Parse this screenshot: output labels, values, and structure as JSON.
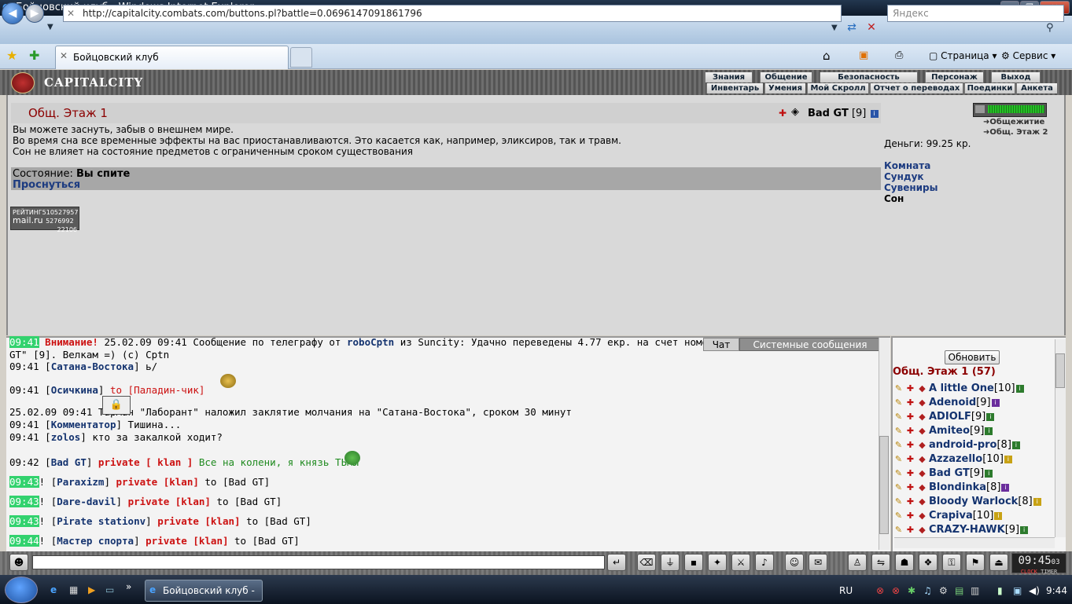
{
  "window": {
    "title": "Бойцовский клуб - Windows Internet Explorer"
  },
  "browser": {
    "url": "http://capitalcity.combats.com/buttons.pl?battle=0.0696147091861796",
    "search_placeholder": "Яндекс",
    "tab_title": "Бойцовский клуб",
    "cmd_page": "Страница",
    "cmd_tools": "Сервис"
  },
  "game": {
    "logo": "CAPITALCITY",
    "menu_top": [
      "Знания",
      "Общение",
      "Безопасность",
      "Персонаж",
      "Выход"
    ],
    "menu_bottom": [
      "Инвентарь",
      "Умения",
      "Мой Скролл",
      "Отчет о переводах",
      "Поединки",
      "Анкета"
    ]
  },
  "room": {
    "title": "Общ. Этаж 1",
    "player": "Bad GT",
    "player_level": "[9]",
    "messages": [
      "Вы можете заснуть, забыв о внешнем мире.",
      "Во время сна все временные эффекты на вас приостанавливаются. Это касается как, например, эликсиров, так и травм.",
      "Сон не влияет на состояние предметов с ограниченным сроком существования"
    ],
    "state_label": "Состояние:",
    "state_value": "Вы спите",
    "wake_link": "Проснуться",
    "rating": {
      "label": "РЕЙТИНГ",
      "mail": "mail.ru",
      "n1": "510527957",
      "n2": "5276992",
      "n3": "22106"
    }
  },
  "sidebar": {
    "money": "Деньги: 99.25 кр.",
    "nav": [
      "Общежитие",
      "Общ. Этаж 2"
    ],
    "links": [
      "Комната",
      "Сундук",
      "Сувениры"
    ],
    "current": "Сон"
  },
  "chat": {
    "tabs": [
      "Чат",
      "Системные сообщения"
    ],
    "lines": [
      {
        "time": "09:41",
        "hl": true,
        "pre": "",
        "parts": [
          {
            "t": "Внимание! ",
            "c": "pv"
          },
          {
            "t": "25.02.09 09:41 Сообщение по телеграфу от ",
            "c": ""
          },
          {
            "t": "roboCptn",
            "c": "nm"
          },
          {
            "t": " из Suncity: Удачно переведены 4.77 екр. на счет номер",
            "c": ""
          }
        ]
      },
      {
        "time": "",
        "hl": false,
        "pre": "",
        "parts": [
          {
            "t": "GT\" [9]. Велкам =) (с) Cptn",
            "c": ""
          }
        ]
      },
      {
        "time": "09:41",
        "hl": false,
        "pre": "",
        "parts": [
          {
            "t": "[",
            "c": ""
          },
          {
            "t": "Сатана-Востока",
            "c": "nm"
          },
          {
            "t": "] ь/",
            "c": ""
          }
        ]
      },
      {
        "time": "09:41",
        "hl": false,
        "pre": "",
        "parts": [
          {
            "t": "[",
            "c": ""
          },
          {
            "t": "Осичкина",
            "c": "nm"
          },
          {
            "t": "] ",
            "c": ""
          },
          {
            "t": "to [Паладин-чик]",
            "c": "pvn"
          }
        ]
      },
      {
        "time": "25.02.09 09:41",
        "hl": false,
        "pre": "",
        "parts": [
          {
            "t": "  Тарман \"Лаборант\" наложил заклятие молчания на \"Сатана-Востока\", сроком 30 минут",
            "c": ""
          }
        ]
      },
      {
        "time": "09:41",
        "hl": false,
        "pre": "",
        "parts": [
          {
            "t": "[",
            "c": ""
          },
          {
            "t": "Комментатор",
            "c": "nm"
          },
          {
            "t": "] Тишина...",
            "c": ""
          }
        ]
      },
      {
        "time": "09:41",
        "hl": false,
        "pre": "",
        "parts": [
          {
            "t": "[",
            "c": ""
          },
          {
            "t": "zolos",
            "c": "nm"
          },
          {
            "t": "] кто за закалкой ходит?",
            "c": ""
          }
        ]
      },
      {
        "time": "09:42",
        "hl": false,
        "pre": "",
        "parts": [
          {
            "t": "[",
            "c": ""
          },
          {
            "t": "Bad GT",
            "c": "nm"
          },
          {
            "t": "] ",
            "c": ""
          },
          {
            "t": "private [ klan ]",
            "c": "pv"
          },
          {
            "t": " Все на колени, я князь ТЬМЫ",
            "c": "gr"
          }
        ]
      },
      {
        "time": "09:43",
        "hl": true,
        "pre": "! ",
        "parts": [
          {
            "t": "[",
            "c": ""
          },
          {
            "t": "Paraxizm",
            "c": "nm"
          },
          {
            "t": "] ",
            "c": ""
          },
          {
            "t": "private [klan]",
            "c": "pv"
          },
          {
            "t": " to [Bad GT]",
            "c": ""
          }
        ]
      },
      {
        "time": "09:43",
        "hl": true,
        "pre": "! ",
        "parts": [
          {
            "t": "[",
            "c": ""
          },
          {
            "t": "Dare-davil",
            "c": "nm"
          },
          {
            "t": "] ",
            "c": ""
          },
          {
            "t": "private [klan]",
            "c": "pv"
          },
          {
            "t": " to [Bad GT]",
            "c": ""
          }
        ]
      },
      {
        "time": "09:43",
        "hl": true,
        "pre": "! ",
        "parts": [
          {
            "t": "[",
            "c": ""
          },
          {
            "t": "Pirate stationv",
            "c": "nm"
          },
          {
            "t": "] ",
            "c": ""
          },
          {
            "t": "private [klan]",
            "c": "pv"
          },
          {
            "t": " to [Bad GT]",
            "c": ""
          }
        ]
      },
      {
        "time": "09:44",
        "hl": true,
        "pre": "! ",
        "parts": [
          {
            "t": "[",
            "c": ""
          },
          {
            "t": "Мастер спорта",
            "c": "nm"
          },
          {
            "t": "] ",
            "c": ""
          },
          {
            "t": "private [klan]",
            "c": "pv"
          },
          {
            "t": " to [Bad GT]",
            "c": ""
          }
        ]
      }
    ]
  },
  "userlist": {
    "refresh": "Обновить",
    "title": "Общ. Этаж 1 (57)",
    "users": [
      {
        "name": "A little One",
        "lvl": "[10]",
        "info": "g"
      },
      {
        "name": "Adenoid",
        "lvl": "[9]",
        "info": "p"
      },
      {
        "name": "ADIOLF",
        "lvl": "[9]",
        "info": "g"
      },
      {
        "name": "Amiteo",
        "lvl": "[9]",
        "info": "g"
      },
      {
        "name": "android-pro",
        "lvl": "[8]",
        "info": "g"
      },
      {
        "name": "Azzazello",
        "lvl": "[10]",
        "info": "y"
      },
      {
        "name": "Bad GT",
        "lvl": "[9]",
        "info": "g"
      },
      {
        "name": "Blondinka",
        "lvl": "[8]",
        "info": "p"
      },
      {
        "name": "Bloody Warlock",
        "lvl": "[8]",
        "info": "y"
      },
      {
        "name": "Crapiva",
        "lvl": "[10]",
        "info": "y"
      },
      {
        "name": "CRAZY-HAWK",
        "lvl": "[9]",
        "info": "g"
      }
    ]
  },
  "toolbar": {
    "clock": "09:45",
    "clock_sec": "03",
    "clock_label": "CLOCK",
    "timer_label": "TIMER"
  },
  "taskbar": {
    "task": "Бойцовский клуб - ...",
    "lang": "RU",
    "time": "9:44"
  }
}
